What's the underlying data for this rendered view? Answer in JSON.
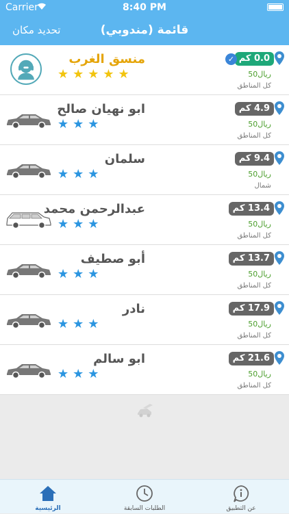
{
  "status_bar": {
    "carrier": "Carrier",
    "time": "8:40 PM"
  },
  "nav": {
    "title": "قائمة (مندوبي)",
    "left_button": "تحديد مكان"
  },
  "rows": [
    {
      "name": "منسق الغرب",
      "distance": "0.0 كم",
      "price": "50ريال",
      "area": "كل المناطق",
      "stars": "★★★★★",
      "verified": true,
      "vehicle": "support-agent-avatar"
    },
    {
      "name": "ابو نهيان صالح",
      "distance": "4.9 كم",
      "price": "50ريال",
      "area": "كل المناطق",
      "stars": "★★★",
      "vehicle": "sedan"
    },
    {
      "name": "سلمان",
      "distance": "9.4 كم",
      "price": "50ريال",
      "area": "شمال",
      "stars": "★★★",
      "vehicle": "sedan"
    },
    {
      "name": "عبدالرحمن محمد",
      "distance": "13.4 كم",
      "price": "50ريال",
      "area": "كل المناطق",
      "stars": "★★★",
      "vehicle": "suv"
    },
    {
      "name": "أبو صطيف",
      "distance": "13.7 كم",
      "price": "50ريال",
      "area": "كل المناطق",
      "stars": "★★★",
      "vehicle": "sedan"
    },
    {
      "name": "نادر",
      "distance": "17.9 كم",
      "price": "50ريال",
      "area": "كل المناطق",
      "stars": "★★★",
      "vehicle": "sedan"
    },
    {
      "name": "ابو سالم",
      "distance": "21.6 كم",
      "price": "50ريال",
      "area": "كل المناطق",
      "stars": "★★★",
      "vehicle": "sedan"
    }
  ],
  "tabs": [
    {
      "label": "الرئيسية",
      "icon": "home-icon",
      "active": true
    },
    {
      "label": "الطلبات السابقة",
      "icon": "clock-icon",
      "active": false
    },
    {
      "label": "عن التطبيق",
      "icon": "info-icon",
      "active": false
    }
  ],
  "colors": {
    "accent": "#5cb6f0",
    "first_distance": "#1ea879",
    "distance_badge": "#666666",
    "stars_blue": "#2b95e0",
    "stars_gold": "#f2c40f",
    "price_green": "#4a9e2a"
  }
}
